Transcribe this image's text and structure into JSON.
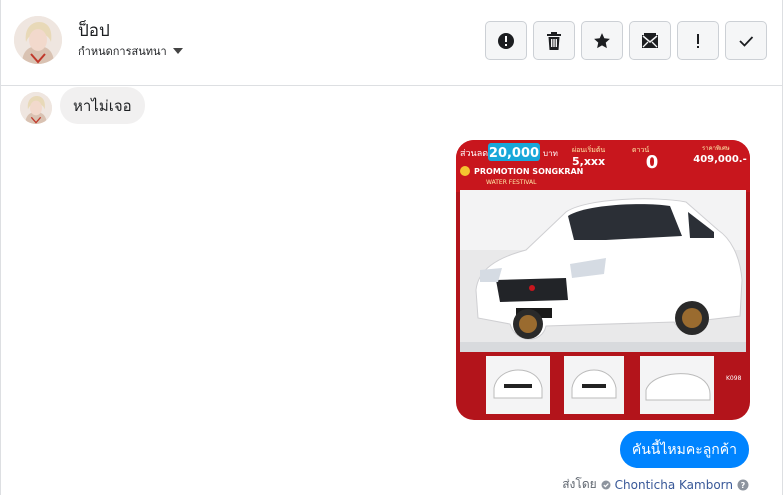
{
  "header": {
    "contact_name": "ป็อป",
    "conversation_settings_label": "กำหนดการสนทนา",
    "actions": [
      {
        "name": "report-spam-button",
        "icon": "alert-circle-icon"
      },
      {
        "name": "delete-button",
        "icon": "trash-icon"
      },
      {
        "name": "star-button",
        "icon": "star-icon"
      },
      {
        "name": "mark-unread-button",
        "icon": "envelope-icon"
      },
      {
        "name": "follow-up-button",
        "icon": "exclamation-icon"
      },
      {
        "name": "mark-done-button",
        "icon": "check-icon"
      }
    ]
  },
  "messages": {
    "incoming_text": "หาไม่เจอ",
    "outgoing_image": {
      "description_icon": "car-promo-image",
      "discount_label": "ส่วนลด",
      "discount_amount": "20,000",
      "discount_unit": "บาท",
      "monthly_label": "ผ่อนเริ่มต้น",
      "monthly_value": "5,xxx",
      "down_label": "ดาวน์",
      "down_value": "0",
      "price_label": "ราคาพิเศษ",
      "price_value": "409,000.-",
      "promo_line1": "PROMOTION SONGKRAN",
      "promo_line2": "WATER FESTIVAL",
      "model_code": "K098"
    },
    "outgoing_text": "คันนี้ไหมคะลูกค้า",
    "sent_by_label": "ส่งโดย",
    "agent_name": "Chonticha Kamborn"
  },
  "colors": {
    "accent": "#0084ff",
    "promo_red": "#c8161d",
    "border": "#dddfe2"
  }
}
